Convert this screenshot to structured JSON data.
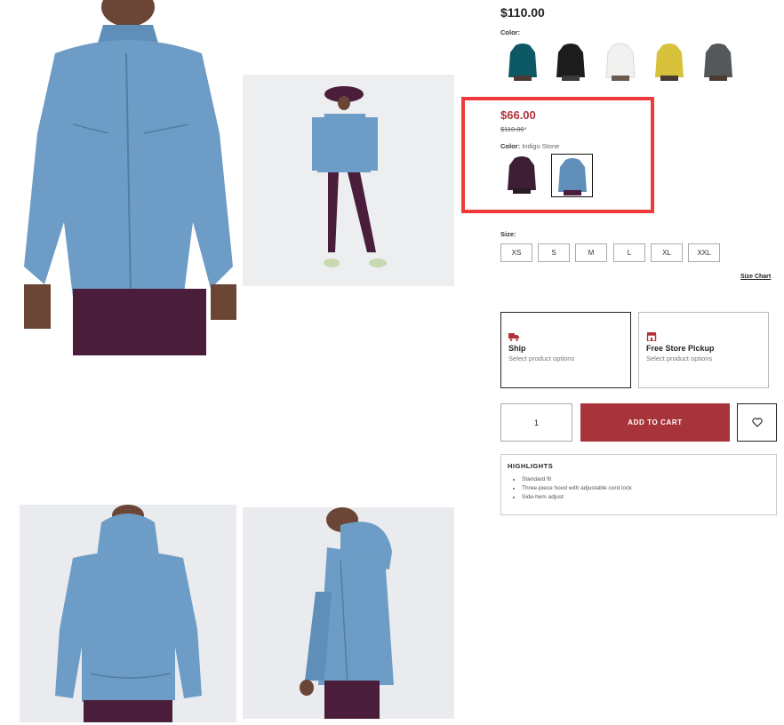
{
  "product": {
    "list_price": "$110.00",
    "color_label": "Color:",
    "colors": [
      {
        "name": "teal",
        "color": "#0d5865"
      },
      {
        "name": "black",
        "color": "#1c1c1c"
      },
      {
        "name": "white",
        "color": "#f1f1f0"
      },
      {
        "name": "yellow",
        "color": "#d8c23c"
      },
      {
        "name": "grey",
        "color": "#55585b"
      }
    ]
  },
  "sale": {
    "price": "$66.00",
    "original_price": "$110.00",
    "original_suffix": "*",
    "color_label": "Color:",
    "color_value": "Indigo Stone",
    "colors": [
      {
        "name": "plum",
        "color": "#3d1e34"
      },
      {
        "name": "indigo-stone",
        "color": "#5f8fb8"
      }
    ],
    "highlight_color": "#ee3a3a"
  },
  "size": {
    "label": "Size:",
    "options": [
      "XS",
      "S",
      "M",
      "L",
      "XL",
      "XXL"
    ],
    "chart_link": "Size Chart"
  },
  "fulfillment": {
    "ship_title": "Ship",
    "ship_sub": "Select product options",
    "pickup_title": "Free Store Pickup",
    "pickup_sub": "Select product options"
  },
  "cart": {
    "quantity": "1",
    "add_label": "ADD TO CART",
    "accent": "#a8343b"
  },
  "highlights": {
    "title": "HIGHLIGHTS",
    "items": [
      "Standard fit",
      "Three-piece hood with adjustable cord lock",
      "Side-hem adjust"
    ]
  }
}
